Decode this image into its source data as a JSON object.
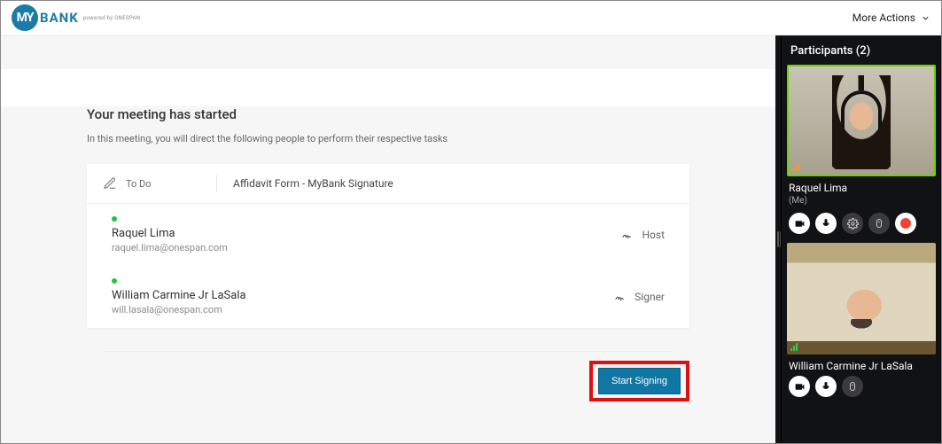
{
  "brand": {
    "circle": "MY",
    "word": "BANK",
    "sub": "powered by ONESPAN"
  },
  "header": {
    "more_actions": "More Actions"
  },
  "meeting": {
    "title": "Your meeting has started",
    "subtitle": "In this meeting, you will direct the following people to perform their respective tasks",
    "todo_label": "To Do",
    "document_name": "Affidavit Form - MyBank Signature"
  },
  "people": [
    {
      "name": "Raquel Lima",
      "email": "raquel.lima@onespan.com",
      "role": "Host",
      "online": true
    },
    {
      "name": "William Carmine Jr LaSala",
      "email": "will.lasala@onespan.com",
      "role": "Signer",
      "online": true
    }
  ],
  "actions": {
    "start_signing": "Start Signing"
  },
  "sidebar": {
    "title": "Participants (2)",
    "participants": [
      {
        "name": "Raquel Lima",
        "meta": "(Me)",
        "is_self": true
      },
      {
        "name": "William Carmine Jr LaSala",
        "meta": "",
        "is_self": false
      }
    ]
  },
  "icons": {
    "camera": "camera-icon",
    "mic": "mic-icon",
    "settings": "gear-icon",
    "mouse": "mouse-icon",
    "record": "record-icon",
    "pen": "pen-icon",
    "signature": "signature-icon",
    "chevron_down": "chevron-down-icon"
  }
}
